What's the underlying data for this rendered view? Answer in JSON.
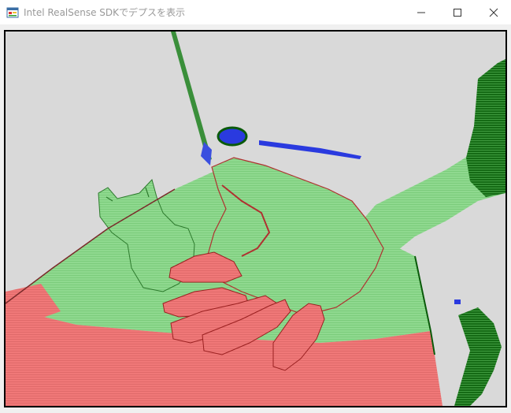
{
  "window": {
    "title": "Intel RealSense SDKでデプスを表示",
    "icon": "app-form-icon",
    "controls": {
      "minimize_icon": "minimize-icon",
      "maximize_icon": "maximize-icon",
      "close_icon": "close-icon"
    }
  },
  "depth_view": {
    "description_icon": "depth-image",
    "colors": {
      "background": "#d9d9d9",
      "near": "#f07878",
      "mid": "#8fd98f",
      "far_edge": "#0a5a0a",
      "farthest": "#2a3adf",
      "border": "#000000"
    }
  }
}
